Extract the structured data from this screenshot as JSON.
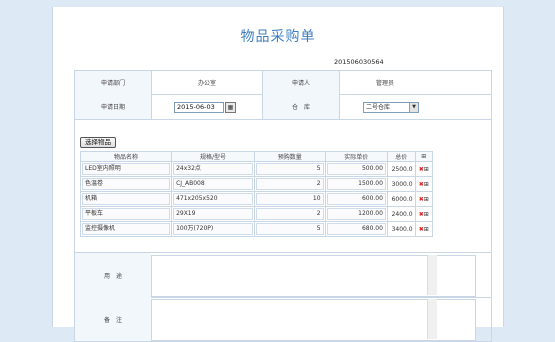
{
  "form": {
    "title": "物品采购单",
    "doc_no": "201506030564"
  },
  "header": {
    "dept_label": "申请部门",
    "dept_value": "办公室",
    "applicant_label": "申请人",
    "applicant_value": "管理员",
    "date_label": "申请日期",
    "date_value": "2015-06-03",
    "warehouse_label": "仓　库",
    "warehouse_value": "二号仓库"
  },
  "select_button": "选择物品",
  "items_table": {
    "columns": [
      "物品名称",
      "规格/型号",
      "预购数量",
      "实际单价",
      "总价",
      "⊞"
    ],
    "rows": [
      {
        "name": "LED室内照明",
        "spec": "24x32点",
        "qty": "5",
        "price": "500.00",
        "total": "2500.0"
      },
      {
        "name": "色温卷",
        "spec": "CJ_AB008",
        "qty": "2",
        "price": "1500.00",
        "total": "3000.0"
      },
      {
        "name": "机箱",
        "spec": "471x205x520",
        "qty": "10",
        "price": "600.00",
        "total": "6000.0"
      },
      {
        "name": "平板车",
        "spec": "29X19",
        "qty": "2",
        "price": "1200.00",
        "total": "2400.0"
      },
      {
        "name": "监控摄像机",
        "spec": "100万(720P)",
        "qty": "5",
        "price": "680.00",
        "total": "3400.0"
      }
    ]
  },
  "purpose_label": "用　途",
  "remark_label": "备　注",
  "icons": {
    "delete": "delete-icon",
    "add_row": "add-row-icon",
    "calendar": "calendar-icon"
  },
  "colors": {
    "title": "#3f7fc0",
    "background": "#dde9f5",
    "border": "#c8d6e6"
  }
}
